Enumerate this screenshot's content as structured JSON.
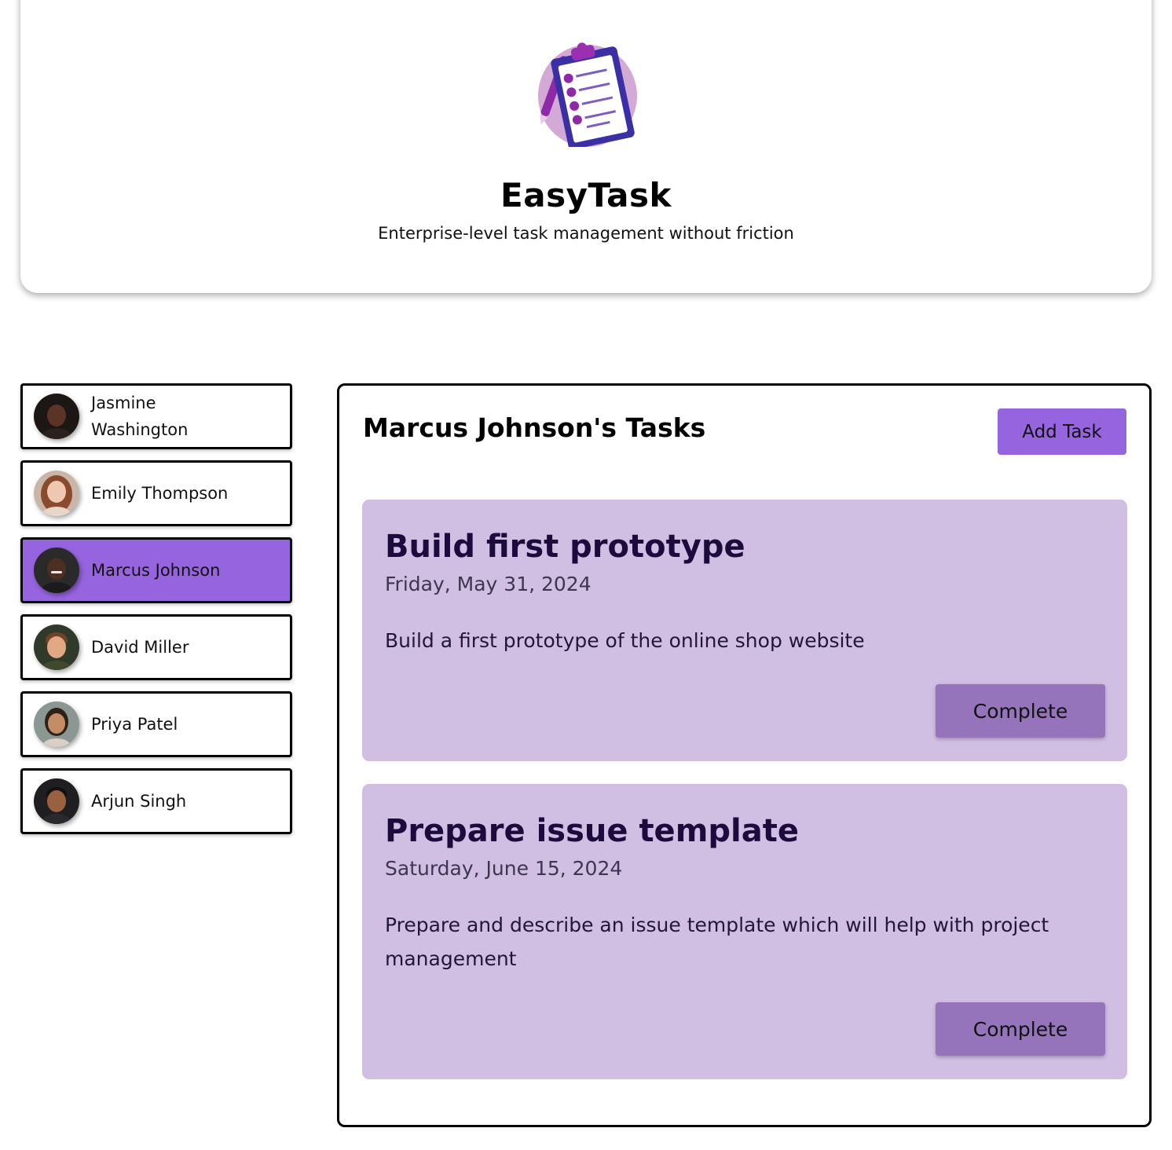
{
  "app": {
    "title": "EasyTask",
    "subtitle": "Enterprise-level task management without friction",
    "logo_icon": "clipboard-checklist-icon"
  },
  "users": [
    {
      "name": "Jasmine Washington",
      "selected": false
    },
    {
      "name": "Emily Thompson",
      "selected": false
    },
    {
      "name": "Marcus Johnson",
      "selected": true
    },
    {
      "name": "David Miller",
      "selected": false
    },
    {
      "name": "Priya Patel",
      "selected": false
    },
    {
      "name": "Arjun Singh",
      "selected": false
    }
  ],
  "tasks_panel": {
    "title": "Marcus Johnson's Tasks",
    "add_task_label": "Add Task",
    "tasks": [
      {
        "title": "Build first prototype",
        "date": "Friday, May 31, 2024",
        "description": "Build a first prototype of the online shop website",
        "complete_label": "Complete"
      },
      {
        "title": "Prepare issue template",
        "date": "Saturday, June 15, 2024",
        "description": "Prepare and describe an issue template which will help with project management",
        "complete_label": "Complete"
      }
    ]
  },
  "colors": {
    "accent": "#9664de",
    "task_card": "#d1bee3",
    "complete_button": "#9574bb"
  }
}
